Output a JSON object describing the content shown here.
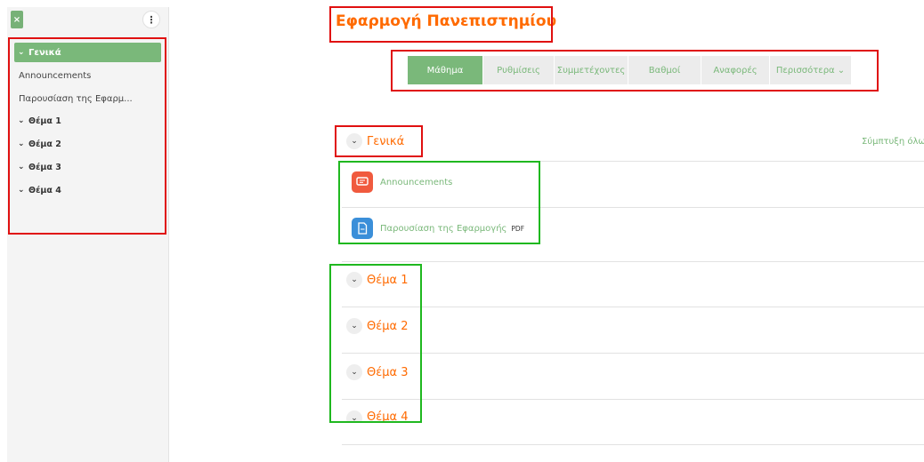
{
  "sidebar": {
    "close_label": "×",
    "menu_label": "⋮",
    "items": [
      {
        "label": "Γενικά",
        "type": "section",
        "active": true
      },
      {
        "label": "Announcements",
        "type": "activity"
      },
      {
        "label": "Παρουσίαση της Εφαρμ...",
        "type": "activity"
      },
      {
        "label": "Θέμα 1",
        "type": "section"
      },
      {
        "label": "Θέμα 2",
        "type": "section"
      },
      {
        "label": "Θέμα 3",
        "type": "section"
      },
      {
        "label": "Θέμα 4",
        "type": "section"
      }
    ]
  },
  "course": {
    "title": "Εφαρμογή Πανεπιστημίου"
  },
  "nav": {
    "tabs": [
      {
        "label": "Μάθημα",
        "active": true
      },
      {
        "label": "Ρυθμίσεις"
      },
      {
        "label": "Συμμετέχοντες"
      },
      {
        "label": "Βαθμοί"
      },
      {
        "label": "Αναφορές"
      },
      {
        "label": "Περισσότερα ⌄"
      }
    ]
  },
  "sections": {
    "general": "Γενικά",
    "collapse_all": "Σύμπτυξη όλω",
    "topics": [
      "Θέμα 1",
      "Θέμα 2",
      "Θέμα 3",
      "Θέμα 4"
    ]
  },
  "activities": [
    {
      "name": "Announcements",
      "icon": "forum-icon"
    },
    {
      "name": "Παρουσίαση της Εφαρμογής",
      "icon": "file-icon",
      "badge": "PDF"
    }
  ],
  "colors": {
    "accent": "#7ab87a",
    "title": "#ff6a00",
    "annotation_red": "#e01010",
    "annotation_green": "#1fb81f"
  }
}
